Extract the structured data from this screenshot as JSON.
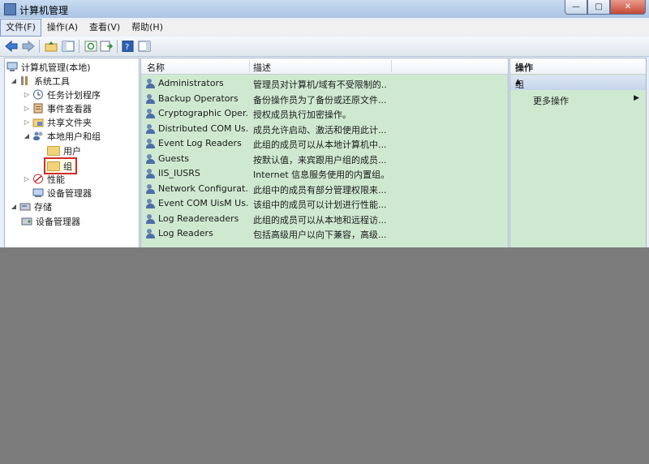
{
  "window": {
    "title": "计算机管理",
    "controls": {
      "minimize": "—",
      "maximize": "□",
      "close": "✕"
    }
  },
  "menu": {
    "items": [
      "文件(F)",
      "操作(A)",
      "查看(V)",
      "帮助(H)"
    ]
  },
  "toolbar": {
    "buttons": [
      "back-arrow-icon",
      "forward-arrow-icon",
      "up-folder-icon",
      "show-hide-tree-icon",
      "refresh-icon",
      "export-list-icon",
      "help-icon",
      "show-hide-action-pane-icon"
    ]
  },
  "tree": {
    "root": "计算机管理(本地)",
    "system_tools": "系统工具",
    "task_scheduler": "任务计划程序",
    "event_viewer": "事件查看器",
    "shared_folders": "共享文件夹",
    "local_users_groups": "本地用户和组",
    "users": "用户",
    "groups": "组",
    "performance": "性能",
    "device_manager": "设备管理器",
    "storage": "存储",
    "disk_management": "设备管理器"
  },
  "list": {
    "col_name": "名称",
    "col_desc": "描述",
    "rows": [
      {
        "name": "Administrators",
        "desc": "管理员对计算机/域有不受限制的..."
      },
      {
        "name": "Backup Operators",
        "desc": "备份操作员为了备份或还原文件..."
      },
      {
        "name": "Cryptographic Oper...",
        "desc": "授权成员执行加密操作。"
      },
      {
        "name": "Distributed COM Us...",
        "desc": "成员允许启动、激活和使用此计..."
      },
      {
        "name": "Event Log Readers",
        "desc": "此组的成员可以从本地计算机中..."
      },
      {
        "name": "Guests",
        "desc": "按默认值，来宾跟用户组的成员..."
      },
      {
        "name": "IIS_IUSRS",
        "desc": "Internet 信息服务使用的内置组。"
      },
      {
        "name": "Network Configurat...",
        "desc": "此组中的成员有部分管理权限来..."
      },
      {
        "name": "Event COM UisM Us...",
        "desc": "该组中的成员可以计划进行性能..."
      },
      {
        "name": "Log Readereaders",
        "desc": "此组的成员可以从本地和远程访..."
      },
      {
        "name": "Log Readers",
        "desc": "包括高级用户以向下兼容，高级..."
      }
    ]
  },
  "actions": {
    "header": "操作",
    "section": "组",
    "more": "更多操作"
  }
}
